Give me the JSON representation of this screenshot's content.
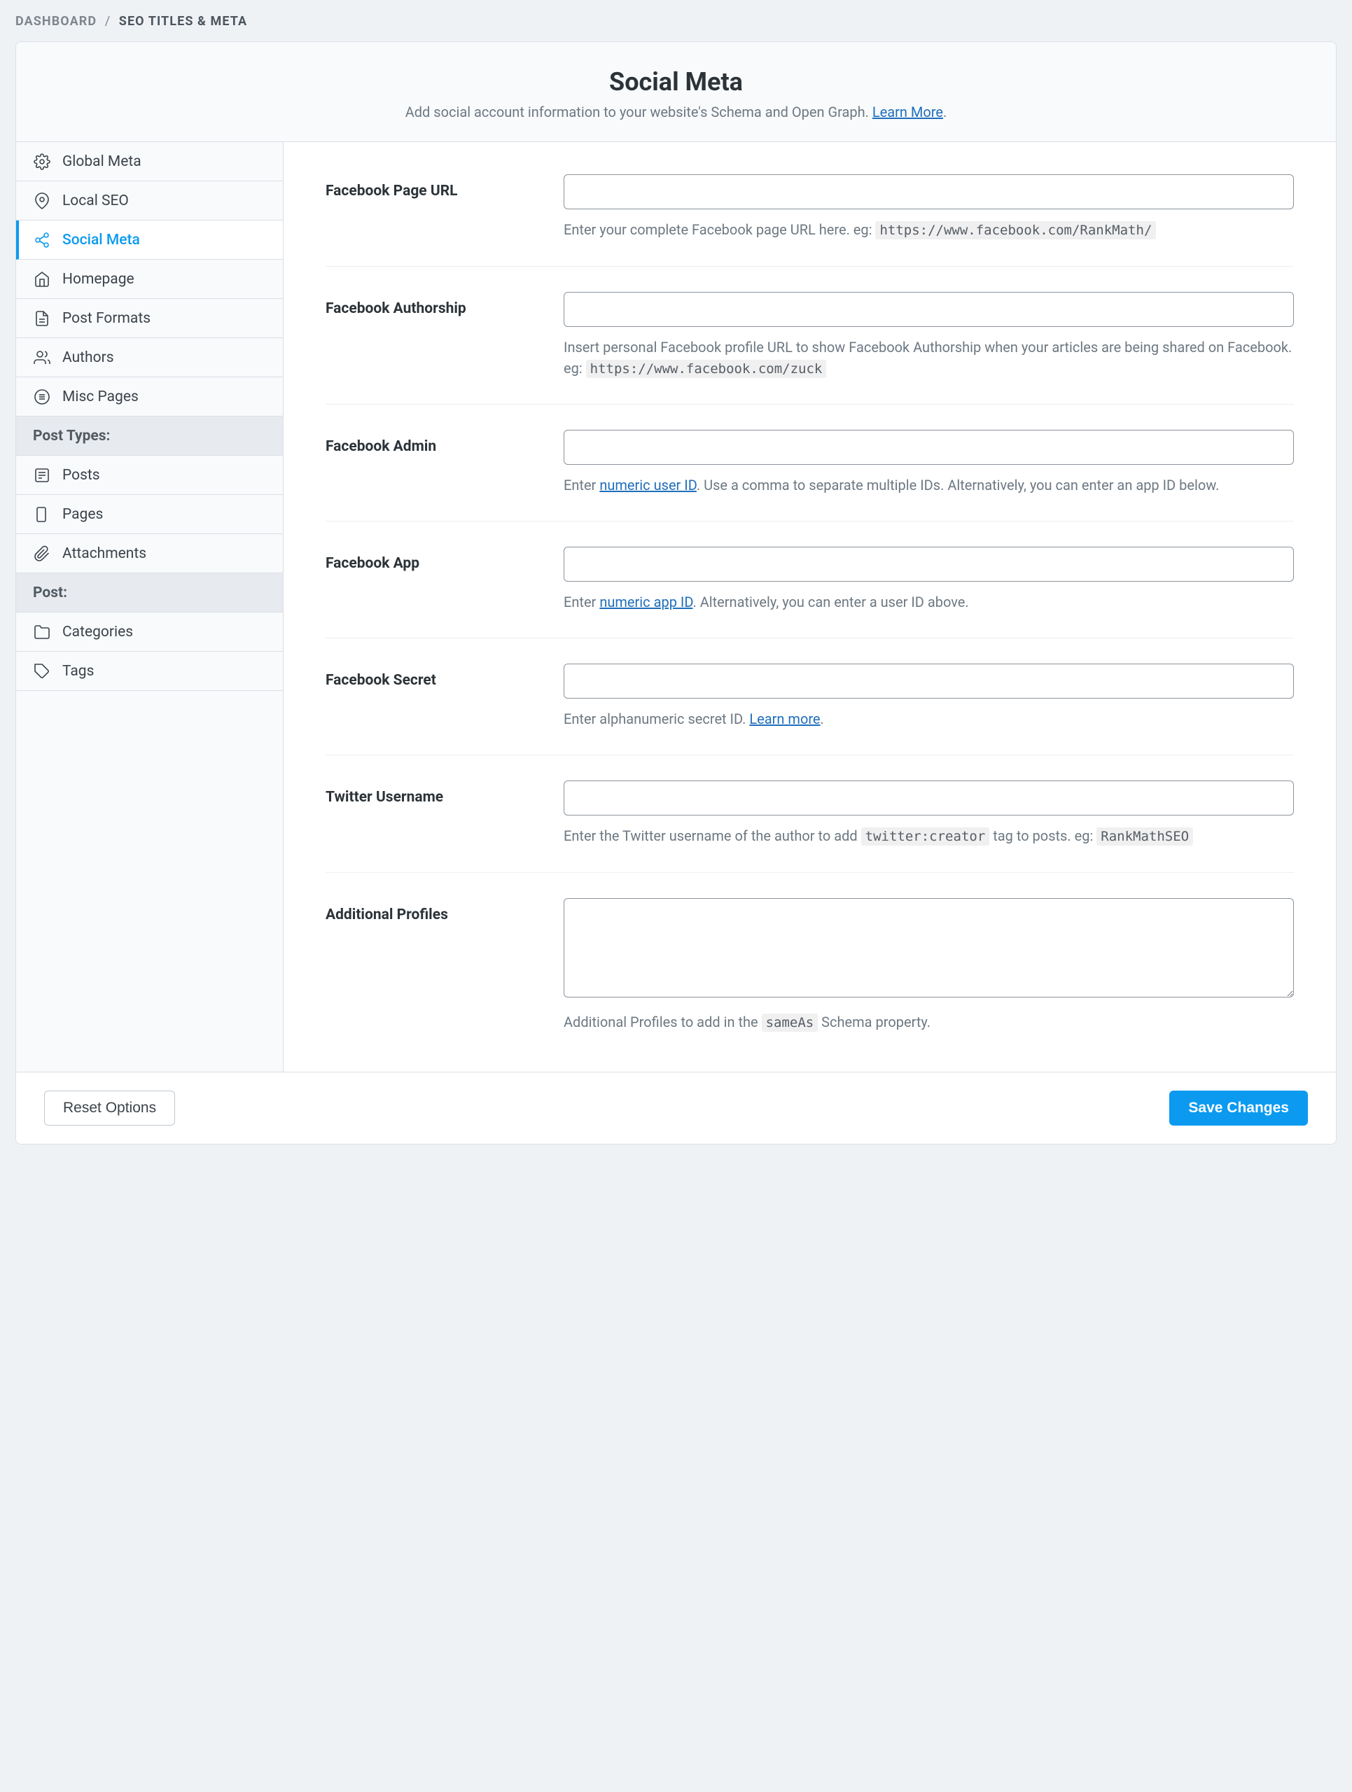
{
  "breadcrumb": {
    "root": "DASHBOARD",
    "current": "SEO TITLES & META"
  },
  "header": {
    "title": "Social Meta",
    "subtitle_pre": "Add social account information to your website's Schema and Open Graph. ",
    "learn_more": "Learn More"
  },
  "sidebar": {
    "global_meta": "Global Meta",
    "local_seo": "Local SEO",
    "social_meta": "Social Meta",
    "homepage": "Homepage",
    "post_formats": "Post Formats",
    "authors": "Authors",
    "misc_pages": "Misc Pages",
    "post_types_header": "Post Types:",
    "posts": "Posts",
    "pages": "Pages",
    "attachments": "Attachments",
    "post_header": "Post:",
    "categories": "Categories",
    "tags": "Tags"
  },
  "fields": {
    "fb_page": {
      "label": "Facebook Page URL",
      "help_pre": "Enter your complete Facebook page URL here. eg: ",
      "help_code": "https://www.facebook.com/RankMath/"
    },
    "fb_author": {
      "label": "Facebook Authorship",
      "help_pre": "Insert personal Facebook profile URL to show Facebook Authorship when your articles are being shared on Facebook. eg: ",
      "help_code": "https://www.facebook.com/zuck"
    },
    "fb_admin": {
      "label": "Facebook Admin",
      "help_pre": "Enter ",
      "help_link": "numeric user ID",
      "help_post": ". Use a comma to separate multiple IDs. Alternatively, you can enter an app ID below."
    },
    "fb_app": {
      "label": "Facebook App",
      "help_pre": "Enter ",
      "help_link": "numeric app ID",
      "help_post": ". Alternatively, you can enter a user ID above."
    },
    "fb_secret": {
      "label": "Facebook Secret",
      "help_pre": "Enter alphanumeric secret ID. ",
      "help_link": "Learn more",
      "help_post": "."
    },
    "twitter": {
      "label": "Twitter Username",
      "help_pre": "Enter the Twitter username of the author to add ",
      "help_code1": "twitter:creator",
      "help_mid": " tag to posts. eg: ",
      "help_code2": "RankMathSEO"
    },
    "profiles": {
      "label": "Additional Profiles",
      "help_pre": "Additional Profiles to add in the ",
      "help_code": "sameAs",
      "help_post": " Schema property."
    }
  },
  "footer": {
    "reset": "Reset Options",
    "save": "Save Changes"
  }
}
